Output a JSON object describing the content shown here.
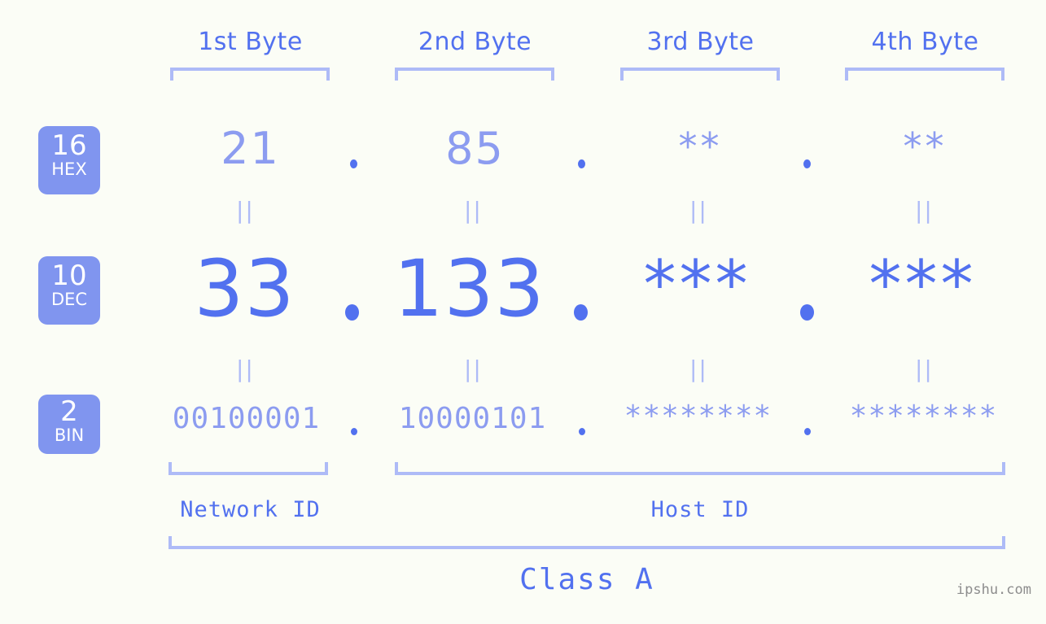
{
  "site": {
    "watermark": "ipshu.com"
  },
  "byte_headers": [
    {
      "label": "1st Byte"
    },
    {
      "label": "2nd Byte"
    },
    {
      "label": "3rd Byte"
    },
    {
      "label": "4th Byte"
    }
  ],
  "bases": [
    {
      "id": "hex",
      "number": "16",
      "name": "HEX"
    },
    {
      "id": "dec",
      "number": "10",
      "name": "DEC"
    },
    {
      "id": "bin",
      "number": "2",
      "name": "BIN"
    }
  ],
  "rows": {
    "hex": {
      "bytes": [
        "21",
        "85",
        "**",
        "**"
      ]
    },
    "dec": {
      "bytes": [
        "33",
        "133",
        "***",
        "***"
      ]
    },
    "bin": {
      "bytes": [
        "00100001",
        "10000101",
        "********",
        "********"
      ]
    }
  },
  "separators": {
    "dot": ".",
    "equals": "||"
  },
  "id_spans": {
    "network": "Network ID",
    "host": "Host ID"
  },
  "class": {
    "label": "Class A"
  },
  "colors": {
    "background": "#fbfdf6",
    "accent_strong": "#5271ef",
    "accent_light": "#8c9cf0",
    "bracket": "#aebbf7",
    "badge_bg": "#8095ef",
    "badge_text": "#ffffff",
    "watermark": "#8d8d8d"
  }
}
